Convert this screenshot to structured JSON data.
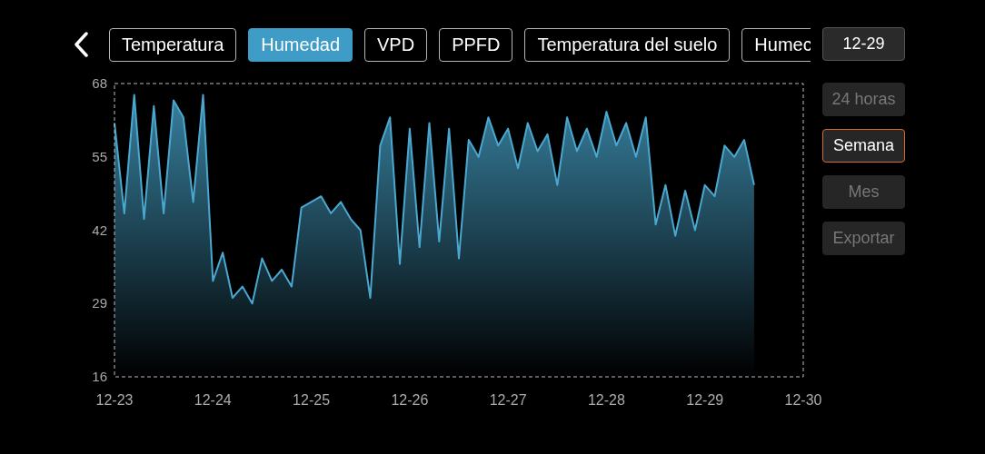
{
  "tabs": [
    {
      "label": "Temperatura",
      "selected": false
    },
    {
      "label": "Humedad",
      "selected": true
    },
    {
      "label": "VPD",
      "selected": false
    },
    {
      "label": "PPFD",
      "selected": false
    },
    {
      "label": "Temperatura del suelo",
      "selected": false
    },
    {
      "label": "Humec",
      "selected": false
    }
  ],
  "date_button": "12-29",
  "range_options": [
    {
      "label": "24 horas",
      "selected": false
    },
    {
      "label": "Semana",
      "selected": true
    },
    {
      "label": "Mes",
      "selected": false
    }
  ],
  "export_button": {
    "label": "Exportar",
    "disabled": true
  },
  "chart_data": {
    "type": "area",
    "categories": [
      "12-23",
      null,
      null,
      null,
      null,
      null,
      null,
      null,
      null,
      null,
      "12-24",
      null,
      null,
      null,
      null,
      null,
      null,
      null,
      null,
      null,
      "12-25",
      null,
      null,
      null,
      null,
      null,
      null,
      null,
      null,
      null,
      "12-26",
      null,
      null,
      null,
      null,
      null,
      null,
      null,
      null,
      null,
      "12-27",
      null,
      null,
      null,
      null,
      null,
      null,
      null,
      null,
      null,
      "12-28",
      null,
      null,
      null,
      null,
      null,
      null,
      null,
      null,
      null,
      "12-29",
      null,
      null,
      null,
      null,
      null,
      null,
      null,
      null,
      null,
      "12-30"
    ],
    "series": [
      {
        "color": "#4aa8d0",
        "values": [
          61,
          45,
          66,
          44,
          64,
          45,
          65,
          62,
          47,
          66,
          33,
          38,
          30,
          32,
          29,
          37,
          33,
          35,
          32,
          46,
          47,
          48,
          45,
          47,
          44,
          42,
          30,
          57,
          62,
          36,
          60,
          39,
          61,
          40,
          60,
          37,
          58,
          55,
          62,
          57,
          60,
          53,
          61,
          56,
          59,
          50,
          62,
          56,
          60,
          55,
          63,
          57,
          61,
          55,
          62,
          43,
          50,
          41,
          49,
          42,
          50,
          48,
          57,
          55,
          58,
          50,
          null,
          null,
          null,
          null,
          null
        ]
      }
    ],
    "ylim": [
      16,
      68
    ],
    "yticks": [
      16,
      29,
      42,
      55,
      68
    ]
  }
}
